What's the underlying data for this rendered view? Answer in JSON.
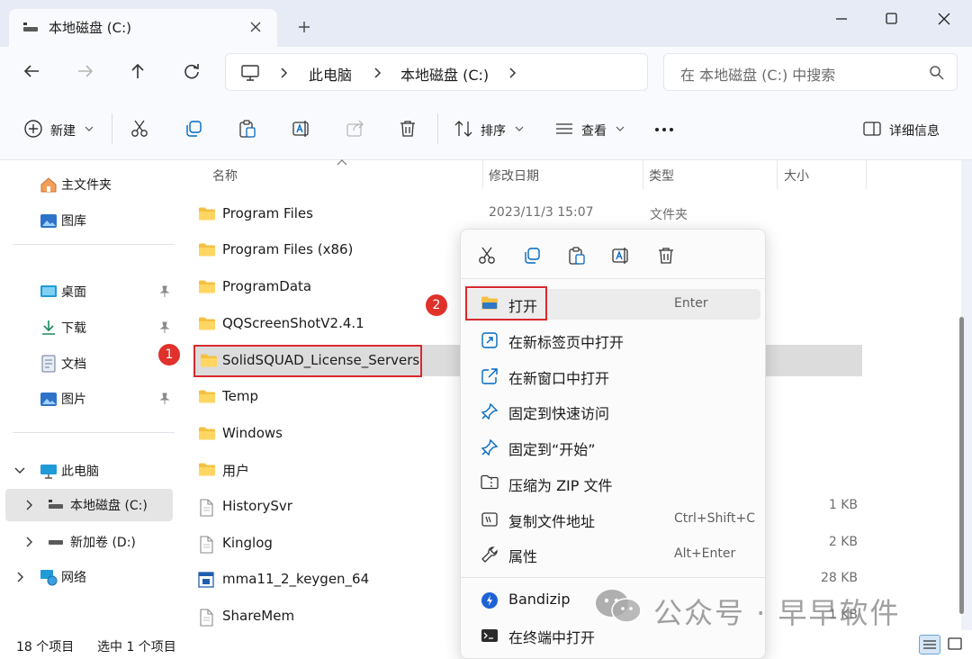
{
  "tab": {
    "title": "本地磁盘 (C:)"
  },
  "breadcrumb": [
    "此电脑",
    "本地磁盘 (C:)"
  ],
  "search": {
    "placeholder": "在 本地磁盘 (C:) 中搜索"
  },
  "toolbar": {
    "new_label": "新建",
    "sort_label": "排序",
    "view_label": "查看",
    "details_label": "详细信息"
  },
  "sidebar": {
    "items": [
      {
        "label": "主文件夹"
      },
      {
        "label": "图库"
      },
      {
        "label": "桌面"
      },
      {
        "label": "下载"
      },
      {
        "label": "文档"
      },
      {
        "label": "图片"
      },
      {
        "label": "此电脑"
      },
      {
        "label": "本地磁盘 (C:)"
      },
      {
        "label": "新加卷 (D:)"
      },
      {
        "label": "网络"
      }
    ]
  },
  "columns": {
    "name": "名称",
    "date": "修改日期",
    "type": "类型",
    "size": "大小"
  },
  "files": [
    {
      "name": "Program Files",
      "date": "2023/11/3 15:07",
      "type": "文件夹",
      "size": ""
    },
    {
      "name": "Program Files (x86)",
      "date": "",
      "type": "",
      "size": ""
    },
    {
      "name": "ProgramData",
      "date": "",
      "type": "",
      "size": ""
    },
    {
      "name": "QQScreenShotV2.4.1",
      "date": "",
      "type": "",
      "size": ""
    },
    {
      "name": "SolidSQUAD_License_Servers",
      "date": "",
      "type": "",
      "size": ""
    },
    {
      "name": "Temp",
      "date": "",
      "type": "",
      "size": ""
    },
    {
      "name": "Windows",
      "date": "",
      "type": "",
      "size": ""
    },
    {
      "name": "用户",
      "date": "",
      "type": "",
      "size": ""
    },
    {
      "name": "HistorySvr",
      "date": "",
      "type": "",
      "size": "1 KB"
    },
    {
      "name": "Kinglog",
      "date": "",
      "type": "",
      "size": "2 KB"
    },
    {
      "name": "mma11_2_keygen_64",
      "date": "",
      "type": "",
      "size": "28 KB"
    },
    {
      "name": "ShareMem",
      "date": "",
      "type": "",
      "size": "1 KB"
    }
  ],
  "status": {
    "count": "18 个项目",
    "selected": "选中 1 个项目"
  },
  "context_menu": {
    "items": [
      {
        "label": "打开",
        "shortcut": "Enter"
      },
      {
        "label": "在新标签页中打开",
        "shortcut": ""
      },
      {
        "label": "在新窗口中打开",
        "shortcut": ""
      },
      {
        "label": "固定到快速访问",
        "shortcut": ""
      },
      {
        "label": "固定到“开始”",
        "shortcut": ""
      },
      {
        "label": "压缩为 ZIP 文件",
        "shortcut": ""
      },
      {
        "label": "复制文件地址",
        "shortcut": "Ctrl+Shift+C"
      },
      {
        "label": "属性",
        "shortcut": "Alt+Enter"
      },
      {
        "label": "Bandizip",
        "shortcut": ""
      },
      {
        "label": "在终端中打开",
        "shortcut": ""
      }
    ]
  },
  "callouts": {
    "one": "1",
    "two": "2"
  },
  "watermark": {
    "text": "公众号 · 早早软件"
  },
  "colors": {
    "accent": "#0067c0",
    "folder": "#f5c042",
    "callout": "#e0312b",
    "selection": "#dcdcdc"
  }
}
